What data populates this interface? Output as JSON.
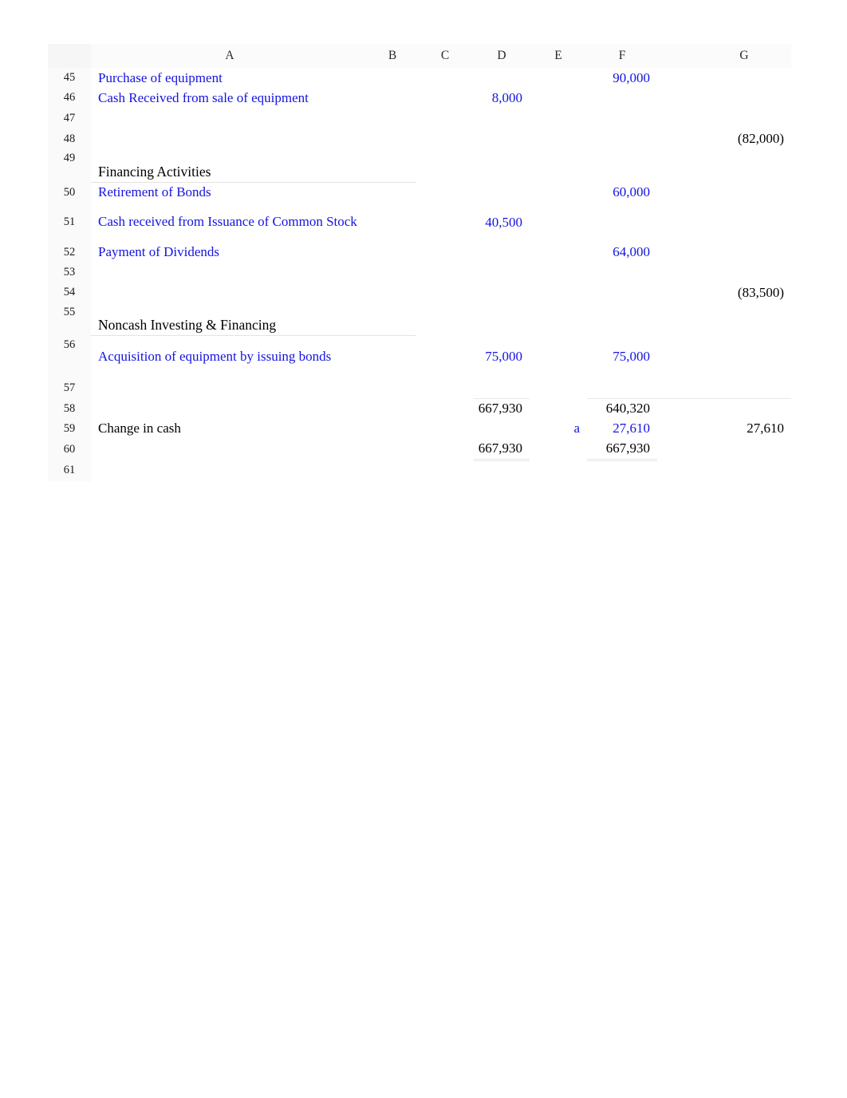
{
  "spreadsheet": {
    "column_headers": [
      "A",
      "B",
      "C",
      "D",
      "E",
      "F",
      "G"
    ],
    "row_numbers": [
      "45",
      "46",
      "47",
      "48",
      "49",
      "50",
      "51",
      "52",
      "53",
      "54",
      "55",
      "56",
      "57",
      "58",
      "59",
      "60",
      "61"
    ],
    "rows": [
      {
        "n": "45",
        "a": "Purchase of equipment",
        "b": "",
        "c": "",
        "d": "",
        "e": "",
        "f": "90,000",
        "g": ""
      },
      {
        "n": "46",
        "a": "Cash Received from sale of equipment",
        "b": "",
        "c": "",
        "d": "8,000",
        "e": "",
        "f": "",
        "g": ""
      },
      {
        "n": "47",
        "a": "",
        "b": "",
        "c": "",
        "d": "",
        "e": "",
        "f": "",
        "g": ""
      },
      {
        "n": "48",
        "a": "",
        "b": "",
        "c": "",
        "d": "",
        "e": "",
        "f": "",
        "g": "(82,000)"
      },
      {
        "n": "49",
        "a": "Financing Activities",
        "b": "",
        "c": "",
        "d": "",
        "e": "",
        "f": "",
        "g": ""
      },
      {
        "n": "50",
        "a": "Retirement of Bonds",
        "b": "",
        "c": "",
        "d": "",
        "e": "",
        "f": "60,000",
        "g": ""
      },
      {
        "n": "51",
        "a": "Cash received from Issuance of Common Stock",
        "b": "",
        "c": "",
        "d": "40,500",
        "e": "",
        "f": "",
        "g": ""
      },
      {
        "n": "52",
        "a": "Payment of Dividends",
        "b": "",
        "c": "",
        "d": "",
        "e": "",
        "f": "64,000",
        "g": ""
      },
      {
        "n": "53",
        "a": "",
        "b": "",
        "c": "",
        "d": "",
        "e": "",
        "f": "",
        "g": ""
      },
      {
        "n": "54",
        "a": "",
        "b": "",
        "c": "",
        "d": "",
        "e": "",
        "f": "",
        "g": "(83,500)"
      },
      {
        "n": "55",
        "a": "Noncash Investing & Financing",
        "b": "",
        "c": "",
        "d": "",
        "e": "",
        "f": "",
        "g": ""
      },
      {
        "n": "56",
        "a": "Acquisition of equipment by issuing bonds",
        "b": "",
        "c": "",
        "d": "75,000",
        "e": "",
        "f": "75,000",
        "g": ""
      },
      {
        "n": "57",
        "a": "",
        "b": "",
        "c": "",
        "d": "",
        "e": "",
        "f": "",
        "g": ""
      },
      {
        "n": "58",
        "a": "",
        "b": "",
        "c": "",
        "d": "667,930",
        "e": "",
        "f": "640,320",
        "g": ""
      },
      {
        "n": "59",
        "a": "Change in cash",
        "b": "",
        "c": "",
        "d": "",
        "e": "a",
        "f": "27,610",
        "g": "27,610"
      },
      {
        "n": "60",
        "a": "",
        "b": "",
        "c": "",
        "d": "667,930",
        "e": "",
        "f": "667,930",
        "g": ""
      },
      {
        "n": "61",
        "a": "",
        "b": "",
        "c": "",
        "d": "",
        "e": "",
        "f": "",
        "g": ""
      }
    ]
  },
  "colors": {
    "entry_blue": "#1414e0",
    "formula_black": "#000000",
    "grid_gray": "#e8e8e8"
  }
}
